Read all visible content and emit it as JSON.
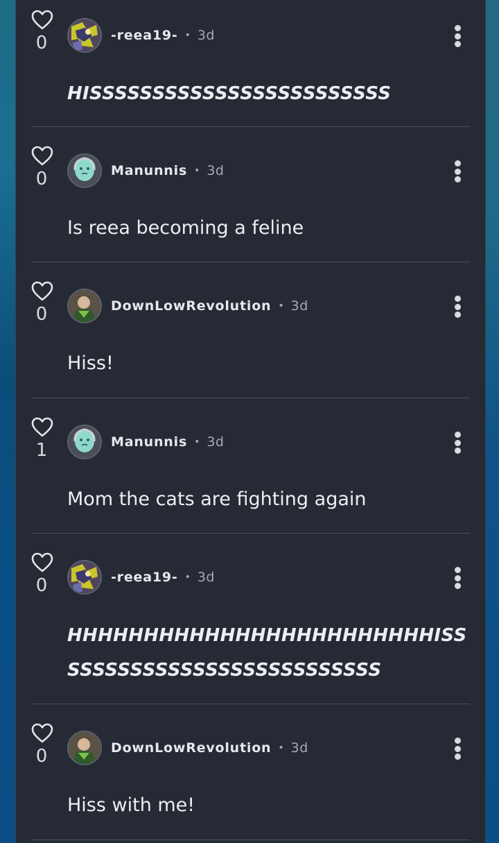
{
  "colors": {
    "panel_bg": "#262a34",
    "text": "#eceef2",
    "muted": "#a6aab3",
    "divider": "#4a4f5a",
    "background": "#0a5790"
  },
  "comments": [
    {
      "likes": "0",
      "username": "-reea19-",
      "separator": "•",
      "time": "3d",
      "avatar": "avatar-reea",
      "text": "HISSSSSSSSSSSSSSSSSSSSSSSS",
      "style": "shout"
    },
    {
      "likes": "0",
      "username": "Manunnis",
      "separator": "•",
      "time": "3d",
      "avatar": "avatar-manunnis",
      "text": "Is reea becoming a feline",
      "style": "normal"
    },
    {
      "likes": "0",
      "username": "DownLowRevolution",
      "separator": "•",
      "time": "3d",
      "avatar": "avatar-downlow",
      "text": "Hiss!",
      "style": "normal"
    },
    {
      "likes": "1",
      "username": "Manunnis",
      "separator": "•",
      "time": "3d",
      "avatar": "avatar-manunnis",
      "text": "Mom the cats are fighting again",
      "style": "normal"
    },
    {
      "likes": "0",
      "username": "-reea19-",
      "separator": "•",
      "time": "3d",
      "avatar": "avatar-reea",
      "text_line1": "HHHHHHHHHHHHHHHHHHHHHHHHISS",
      "text_line2": "SSSSSSSSSSSSSSSSSSSSSSSSS",
      "style": "shout"
    },
    {
      "likes": "0",
      "username": "DownLowRevolution",
      "separator": "•",
      "time": "3d",
      "avatar": "avatar-downlow",
      "text": "Hiss with me!",
      "style": "normal"
    }
  ],
  "icons": {
    "like": "heart-outline-icon",
    "more": "more-vertical-icon"
  }
}
